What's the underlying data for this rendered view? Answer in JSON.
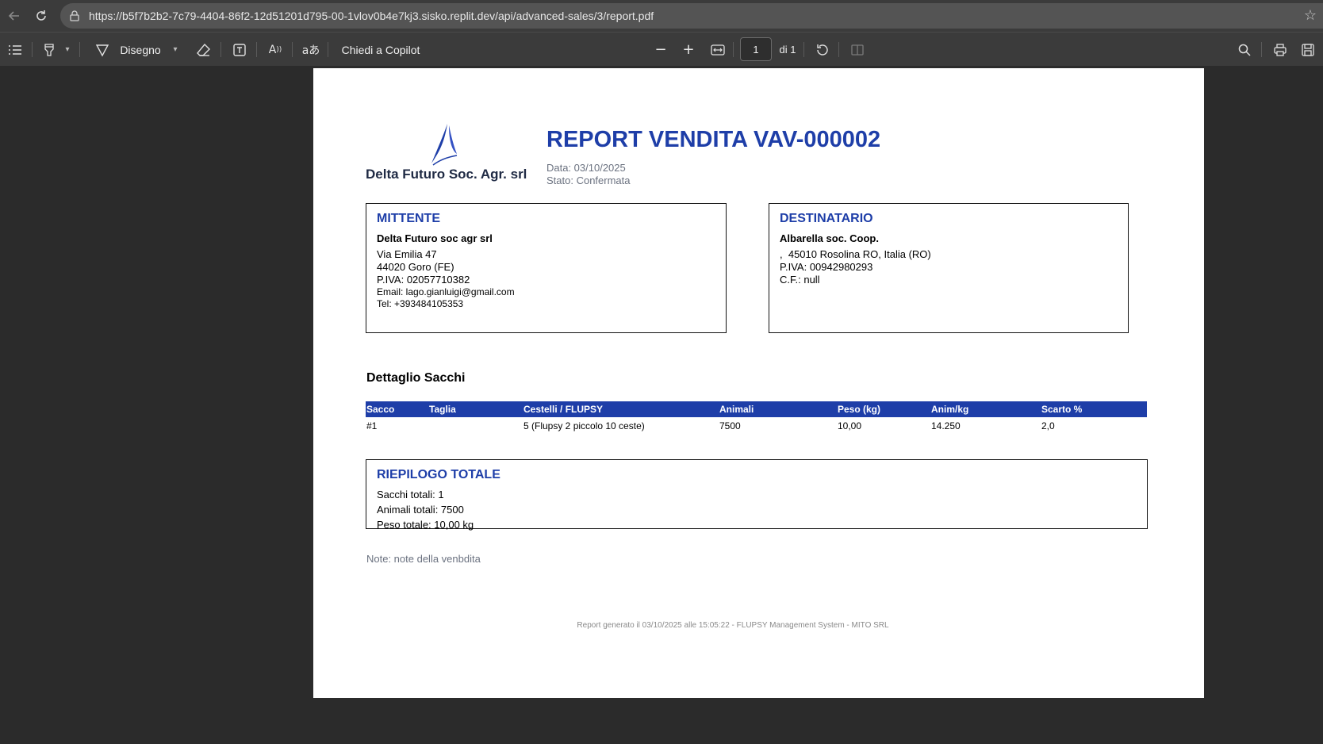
{
  "browser": {
    "url": "https://b5f7b2b2-7c79-4404-86f2-12d51201d795-00-1vlov0b4e7kj3.sisko.replit.dev/api/advanced-sales/3/report.pdf",
    "icons": [
      "back-arrow-icon",
      "reload-icon",
      "lock-icon",
      "star-icon"
    ]
  },
  "pdf_toolbar": {
    "draw_label": "Disegno",
    "copilot_label": "Chiedi a Copilot",
    "page_number": "1",
    "page_total": "di 1",
    "icons": [
      "contents-icon",
      "highlight-icon",
      "draw-icon",
      "eraser-icon",
      "text-box-icon",
      "read-aloud-icon",
      "translate-icon",
      "zoom-out-icon",
      "zoom-in-icon",
      "fit-width-icon",
      "rotate-icon",
      "page-view-icon",
      "search-icon",
      "print-icon",
      "save-icon"
    ]
  },
  "report": {
    "company_logo_text": "Delta Futuro Soc. Agr. srl",
    "title": "REPORT VENDITA VAV-000002",
    "date": "Data: 03/10/2025",
    "status": "Stato: Confermata",
    "sender": {
      "heading": "MITTENTE",
      "name": "Delta Futuro soc agr srl",
      "address": "Via Emilia 47",
      "city": "44020 Goro (FE)",
      "vat": "P.IVA: 02057710382",
      "email": "Email: lago.gianluigi@gmail.com",
      "phone": "Tel: +393484105353"
    },
    "recipient": {
      "heading": "DESTINATARIO",
      "name": "Albarella soc. Coop.",
      "address": ",  45010 Rosolina RO, Italia (RO)",
      "vat": "P.IVA: 00942980293",
      "tax_code": "C.F.: null"
    },
    "details_title": "Dettaglio Sacchi",
    "table": {
      "headers": [
        "Sacco",
        "Taglia",
        "Cestelli / FLUPSY",
        "Animali",
        "Peso (kg)",
        "Anim/kg",
        "Scarto %"
      ],
      "rows": [
        [
          "#1",
          "",
          "5 (Flupsy 2 piccolo 10 ceste)",
          "7500",
          "10,00",
          "14.250",
          "2,0"
        ]
      ]
    },
    "summary": {
      "heading": "RIEPILOGO TOTALE",
      "bags": "Sacchi totali: 1",
      "animals": "Animali totali: 7500",
      "weight": "Peso totale: 10,00 kg"
    },
    "note": "Note: note della venbdita",
    "footer": "Report generato il 03/10/2025 alle 15:05:22 - FLUPSY Management System - MITO SRL"
  },
  "colors": {
    "accent_blue": "#1e3ea8",
    "viewer_background": "#2b2b2b"
  }
}
